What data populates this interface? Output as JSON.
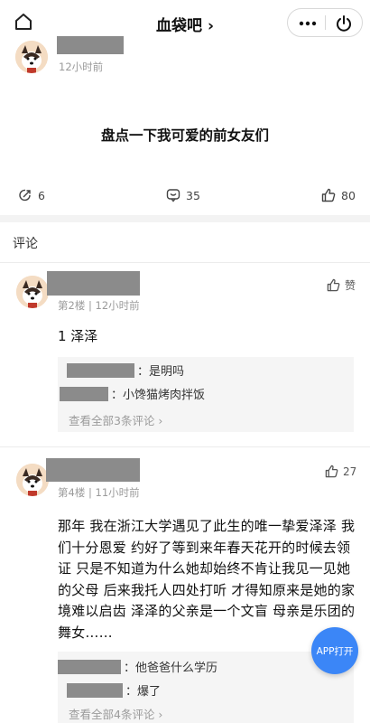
{
  "header": {
    "title": "血袋吧 ›"
  },
  "post": {
    "time": "12小时前",
    "text": "盘点一下我可爱的前女友们",
    "shares": "6",
    "comments": "35",
    "likes": "80"
  },
  "comments_label": "评论",
  "comments": [
    {
      "meta": "第2楼 | 12小时前",
      "like_label": "赞",
      "text": "1 泽泽",
      "replies": [
        "：是明吗",
        "：小馋猫烤肉拌饭"
      ],
      "see_all": "查看全部3条评论 ›"
    },
    {
      "meta": "第4楼 | 11小时前",
      "like_count": "27",
      "text": "那年 我在浙江大学遇见了此生的唯一挚爱泽泽 我们十分恩爱 约好了等到来年春天花开的时候去领证 只是不知道为什么她却始终不肯让我见一见她的父母 后来我托人四处打听 才得知原来是她的家境难以启齿 泽泽的父亲是一个文盲 母亲是乐团的舞女……",
      "replies": [
        "：他爸爸什么学历",
        "：爆了"
      ],
      "see_all": "查看全部4条评论 ›"
    }
  ],
  "app_button": "APP打开",
  "colors": {
    "accent": "#3b86f7",
    "redaction": "#8b8b8b"
  }
}
